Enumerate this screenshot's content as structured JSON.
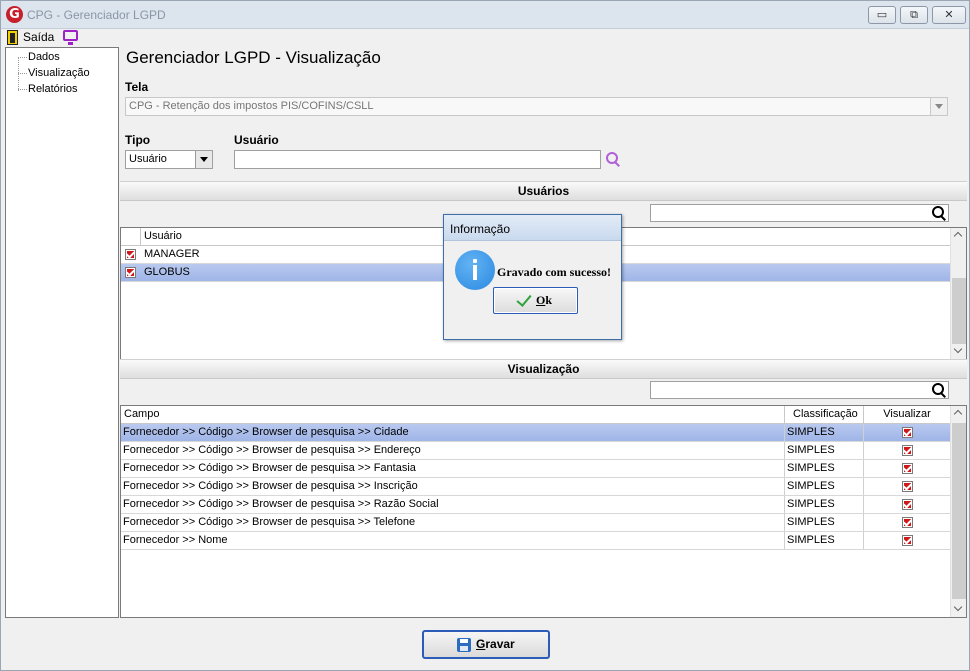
{
  "window": {
    "title": "CPG - Gerenciador LGPD",
    "logo_letter": "G",
    "controls": {
      "minimize": "▭",
      "restore": "⧉",
      "close": "✕"
    }
  },
  "menu": {
    "exit_label": "Saída",
    "icons": [
      "exit-door-icon",
      "monitor-icon"
    ]
  },
  "tree": {
    "items": [
      "Dados",
      "Visualização",
      "Relatórios"
    ]
  },
  "page": {
    "title": "Gerenciador LGPD - Visualização"
  },
  "form": {
    "tela_label": "Tela",
    "tela_value": "CPG - Retenção dos impostos PIS/COFINS/CSLL",
    "tipo_label": "Tipo",
    "tipo_value": "Usuário",
    "usuario_label": "Usuário",
    "usuario_value": ""
  },
  "users_section": {
    "header": "Usuários",
    "filter_value": "",
    "column_header": "Usuário",
    "rows": [
      {
        "name": "MANAGER",
        "checked": true,
        "selected": false
      },
      {
        "name": "GLOBUS",
        "checked": true,
        "selected": true
      }
    ]
  },
  "view_section": {
    "header": "Visualização",
    "filter_value": "",
    "columns": [
      "Campo",
      "Classificação",
      "Visualizar"
    ],
    "rows": [
      {
        "campo": "Fornecedor >> Código >> Browser de pesquisa >> Cidade",
        "classificacao": "SIMPLES",
        "visualizar": true,
        "selected": true
      },
      {
        "campo": "Fornecedor >> Código >> Browser de pesquisa >> Endereço",
        "classificacao": "SIMPLES",
        "visualizar": true,
        "selected": false
      },
      {
        "campo": "Fornecedor >> Código >> Browser de pesquisa >> Fantasia",
        "classificacao": "SIMPLES",
        "visualizar": true,
        "selected": false
      },
      {
        "campo": "Fornecedor >> Código >> Browser de pesquisa >> Inscrição",
        "classificacao": "SIMPLES",
        "visualizar": true,
        "selected": false
      },
      {
        "campo": "Fornecedor >> Código >> Browser de pesquisa >> Razão Social",
        "classificacao": "SIMPLES",
        "visualizar": true,
        "selected": false
      },
      {
        "campo": "Fornecedor >> Código >> Browser de pesquisa >> Telefone",
        "classificacao": "SIMPLES",
        "visualizar": true,
        "selected": false
      },
      {
        "campo": "Fornecedor >> Nome",
        "classificacao": "SIMPLES",
        "visualizar": true,
        "selected": false
      }
    ]
  },
  "save_button": {
    "underline_char": "G",
    "rest": "ravar"
  },
  "dialog": {
    "title": "Informação",
    "message": "Gravado com sucesso!",
    "ok_underline": "O",
    "ok_rest": "k"
  },
  "colors": {
    "selection": "#a9bdec",
    "accent_border": "#2a5cb8",
    "check_red": "#d01818",
    "info_blue": "#2a89e0"
  }
}
